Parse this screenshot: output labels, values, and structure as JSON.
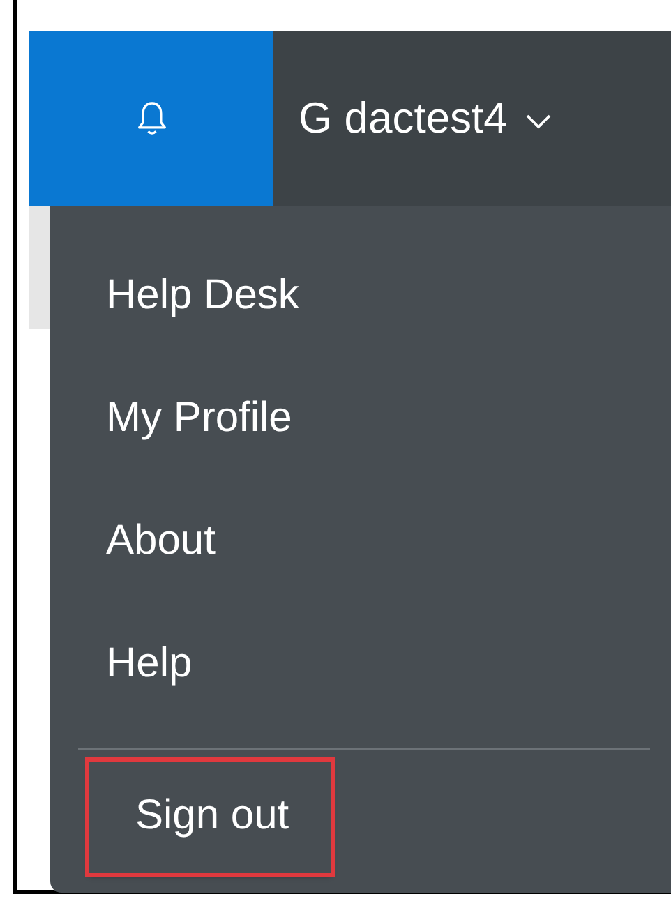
{
  "header": {
    "notifications_selected": true,
    "user": "G dactest4",
    "menu_expanded": true
  },
  "menu": {
    "items": [
      {
        "label": "Help Desk",
        "highlighted": false,
        "divider_before": false
      },
      {
        "label": "My Profile",
        "highlighted": false,
        "divider_before": false
      },
      {
        "label": "About",
        "highlighted": false,
        "divider_before": false
      },
      {
        "label": "Help",
        "highlighted": false,
        "divider_before": false
      },
      {
        "label": "Sign out",
        "highlighted": true,
        "divider_before": true
      }
    ]
  }
}
